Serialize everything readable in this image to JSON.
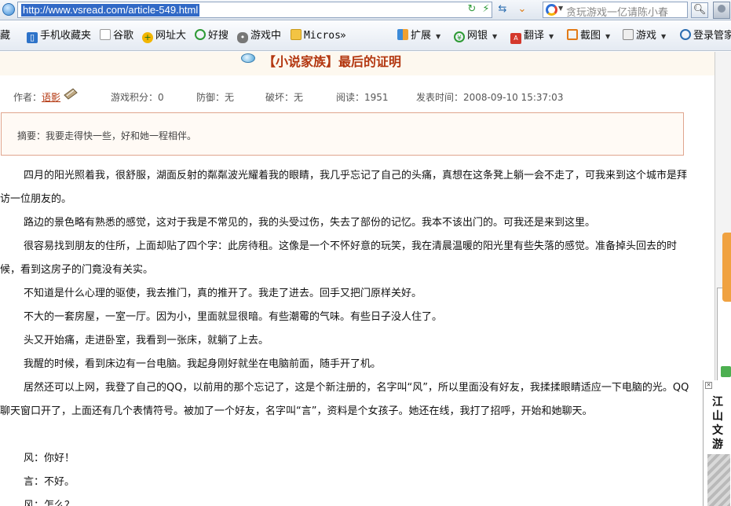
{
  "browser": {
    "url": "http://www.vsread.com/article-549.html",
    "search_placeholder": "贪玩游戏一亿请陈小春"
  },
  "favorites": [
    {
      "label": "藏",
      "icon": "favorites-icon"
    },
    {
      "label": "手机收藏夹",
      "icon": "phone-icon"
    },
    {
      "label": "谷歌",
      "icon": "page-icon"
    },
    {
      "label": "网址大",
      "icon": "plus-globe-icon"
    },
    {
      "label": "好搜",
      "icon": "search-q-icon"
    },
    {
      "label": "游戏中",
      "icon": "gamepad-icon"
    },
    {
      "label": "Micros",
      "icon": "folder-icon"
    },
    {
      "label": "扩展",
      "icon": "extensions-icon"
    },
    {
      "label": "网银",
      "icon": "bank-icon"
    },
    {
      "label": "翻译",
      "icon": "translate-icon"
    },
    {
      "label": "截图",
      "icon": "screenshot-icon"
    },
    {
      "label": "游戏",
      "icon": "game-icon"
    },
    {
      "label": "登录管家",
      "icon": "login-search-icon"
    }
  ],
  "overflow_glyph": "»",
  "article": {
    "title": "【小说家族】最后的证明",
    "author_label": "作者：",
    "author": "语影",
    "score": "游戏积分：0",
    "defense": "防御：无",
    "break": "破坏：无",
    "reads": "阅读：1951",
    "published": "发表时间：2008-09-10 15:37:03",
    "summary": "摘要：我要走得快一些，好和她一程相伴。",
    "paragraphs": [
      "四月的阳光照着我，很舒服，湖面反射的粼粼波光耀着我的眼睛，我几乎忘记了自己的头痛，真想在这条凳上躺一会不走了，可我来到这个城市是拜访一位朋友的。",
      "路边的景色略有熟悉的感觉，这对于我是不常见的，我的头受过伤，失去了部份的记忆。我本不该出门的。可我还是来到这里。",
      "很容易找到朋友的住所，上面却贴了四个字：此房待租。这像是一个不怀好意的玩笑，我在清晨温暖的阳光里有些失落的感觉。准备掉头回去的时候，看到这房子的门竟没有关实。",
      "不知道是什么心理的驱使，我去推门，真的推开了。我走了进去。回手又把门原样关好。",
      "不大的一套房屋，一室一厅。因为小，里面就显很暗。有些潮霉的气味。有些日子没人住了。",
      "头又开始痛，走进卧室，我看到一张床，就躺了上去。",
      "我醒的时候，看到床边有一台电脑。我起身刚好就坐在电脑前面，随手开了机。",
      "居然还可以上网，我登了自己的QQ，以前用的那个忘记了，这是个新注册的，名字叫“风”，所以里面没有好友，我揉揉眼睛适应一下电脑的光。QQ聊天窗口开了，上面还有几个表情符号。被加了一个好友，名字叫“言”，资料是个女孩子。她还在线，我打了招呼，开始和她聊天。"
    ],
    "dialogue": [
      "风：你好！",
      "言：不好。",
      "风：怎么？"
    ]
  },
  "side_widget": {
    "label": "江山文游"
  }
}
